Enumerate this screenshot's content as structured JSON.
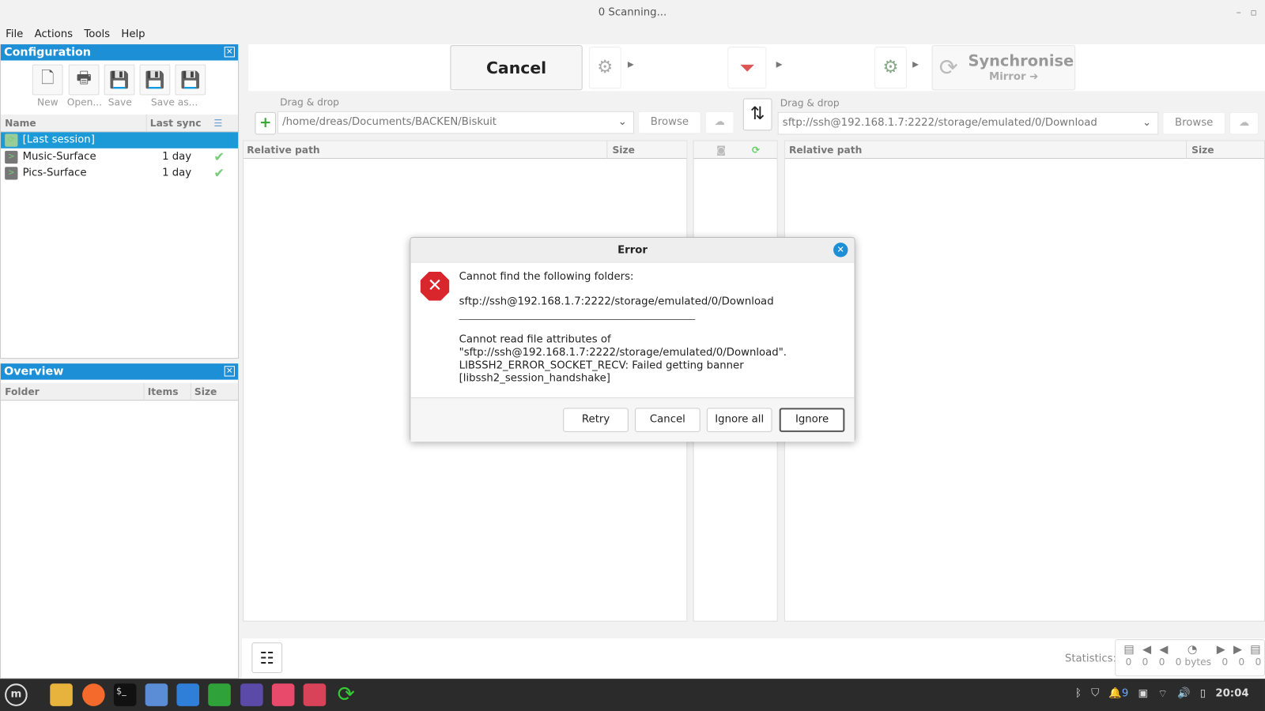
{
  "window": {
    "title": "0 Scanning..."
  },
  "menu": [
    "File",
    "Actions",
    "Tools",
    "Help"
  ],
  "config": {
    "title": "Configuration",
    "buttons": [
      "New",
      "Open...",
      "Save",
      "Save as..."
    ],
    "columns": {
      "name": "Name",
      "last_sync": "Last sync"
    },
    "rows": [
      {
        "name": "[Last session]",
        "last_sync": ""
      },
      {
        "name": "Music-Surface",
        "last_sync": "1 day"
      },
      {
        "name": "Pics-Surface",
        "last_sync": "1 day"
      }
    ]
  },
  "overview": {
    "title": "Overview",
    "columns": [
      "Folder",
      "Items",
      "Size"
    ]
  },
  "toolbar": {
    "cancel": "Cancel",
    "sync": "Synchronise",
    "sync_mode": "Mirror ➔"
  },
  "left": {
    "drag": "Drag & drop",
    "path": "/home/dreas/Documents/BACKEN/Biskuit",
    "browse": "Browse",
    "col_path": "Relative path",
    "col_size": "Size"
  },
  "right": {
    "drag": "Drag & drop",
    "path": "sftp://ssh@192.168.1.7:2222/storage/emulated/0/Download",
    "browse": "Browse",
    "col_path": "Relative path",
    "col_size": "Size"
  },
  "dialog": {
    "title": "Error",
    "line1": "Cannot find the following folders:",
    "line2": "sftp://ssh@192.168.1.7:2222/storage/emulated/0/Download",
    "sep": "_____________________________________________",
    "line3": "Cannot read file attributes of",
    "line4": "\"sftp://ssh@192.168.1.7:2222/storage/emulated/0/Download\".",
    "line5": "LIBSSH2_ERROR_SOCKET_RECV: Failed getting banner",
    "line6": "[libssh2_session_handshake]",
    "buttons": [
      "Retry",
      "Cancel",
      "Ignore all",
      "Ignore"
    ]
  },
  "stats": {
    "label": "Statistics:",
    "values": [
      "0",
      "0",
      "0",
      "0 bytes",
      "0",
      "0",
      "0"
    ]
  },
  "tray": {
    "notifications": "9",
    "clock": "20:04"
  },
  "colors": {
    "accent": "#1c8fd6",
    "error": "#d9262c"
  }
}
